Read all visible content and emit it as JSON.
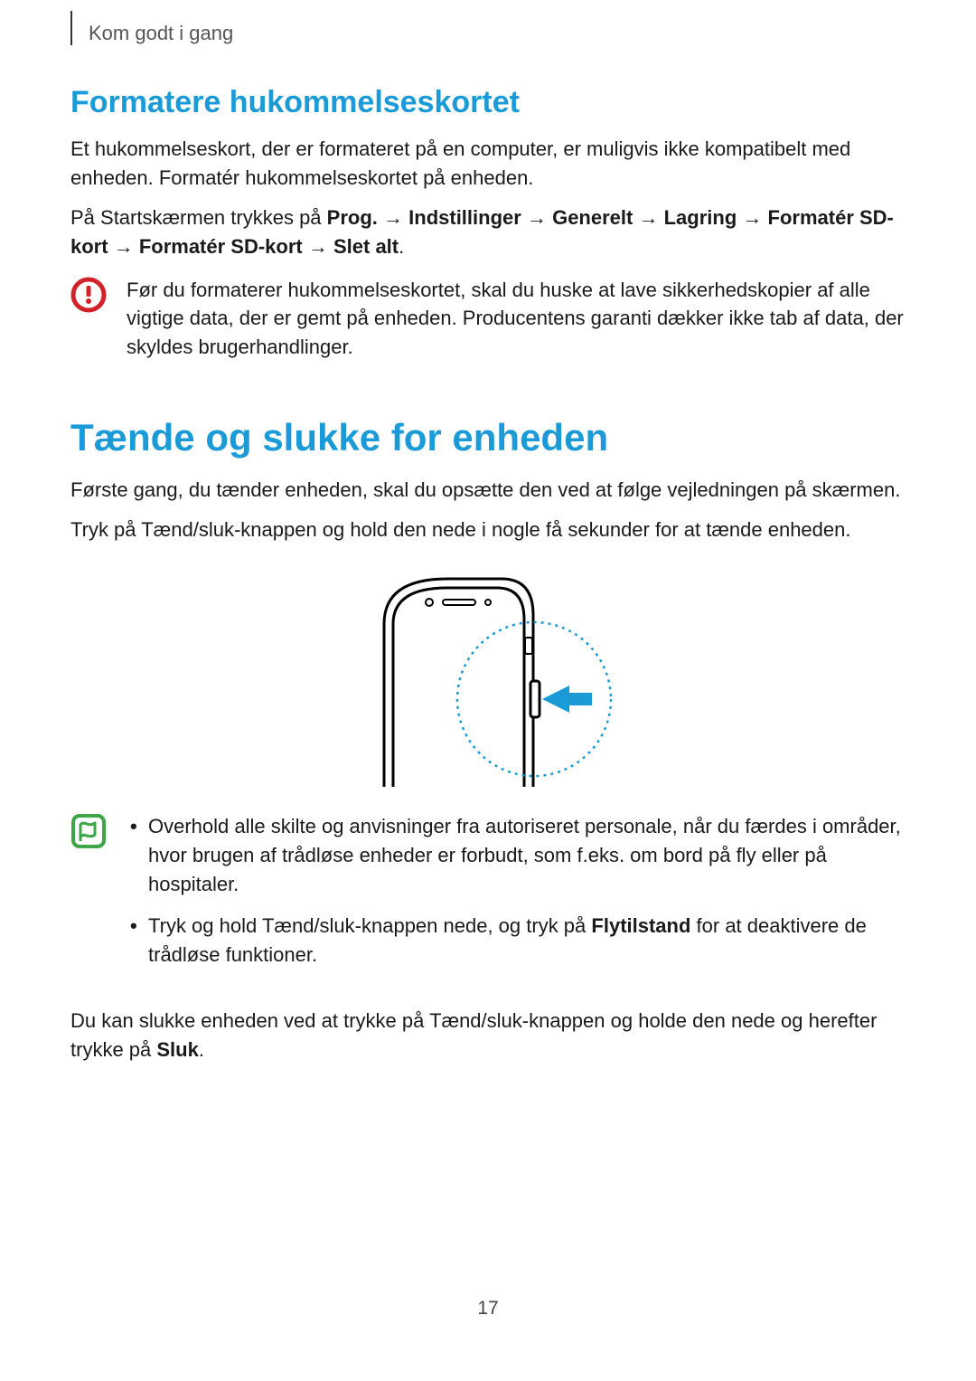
{
  "breadcrumb": "Kom godt i gang",
  "section1": {
    "heading": "Formatere hukommelseskortet",
    "p1": "Et hukommelseskort, der er formateret på en computer, er muligvis ikke kompatibelt med enheden. Formatér hukommelseskortet på enheden.",
    "p2_prefix": "På Startskærmen trykkes på ",
    "path": {
      "prog": "Prog.",
      "indstillinger": "Indstillinger",
      "generelt": "Generelt",
      "lagring": "Lagring",
      "formater1": "Formatér SD-kort",
      "formater2": "Formatér SD-kort",
      "slet": "Slet alt"
    },
    "arrow": "→",
    "warning": "Før du formaterer hukommelseskortet, skal du huske at lave sikkerhedskopier af alle vigtige data, der er gemt på enheden. Producentens garanti dækker ikke tab af data, der skyldes brugerhandlinger."
  },
  "section2": {
    "heading": "Tænde og slukke for enheden",
    "p1": "Første gang, du tænder enheden, skal du opsætte den ved at følge vejledningen på skærmen.",
    "p2": "Tryk på Tænd/sluk-knappen og hold den nede i nogle få sekunder for at tænde enheden.",
    "note_item1": "Overhold alle skilte og anvisninger fra autoriseret personale, når du færdes i områder, hvor brugen af trådløse enheder er forbudt, som f.eks. om bord på fly eller på hospitaler.",
    "note_item2_pre": "Tryk og hold Tænd/sluk-knappen nede, og tryk på ",
    "note_item2_bold": "Flytilstand",
    "note_item2_post": " for at deaktivere de trådløse funktioner.",
    "p3_pre": "Du kan slukke enheden ved at trykke på Tænd/sluk-knappen og holde den nede og herefter trykke på ",
    "p3_bold": "Sluk",
    "p3_post": "."
  },
  "page_number": "17"
}
